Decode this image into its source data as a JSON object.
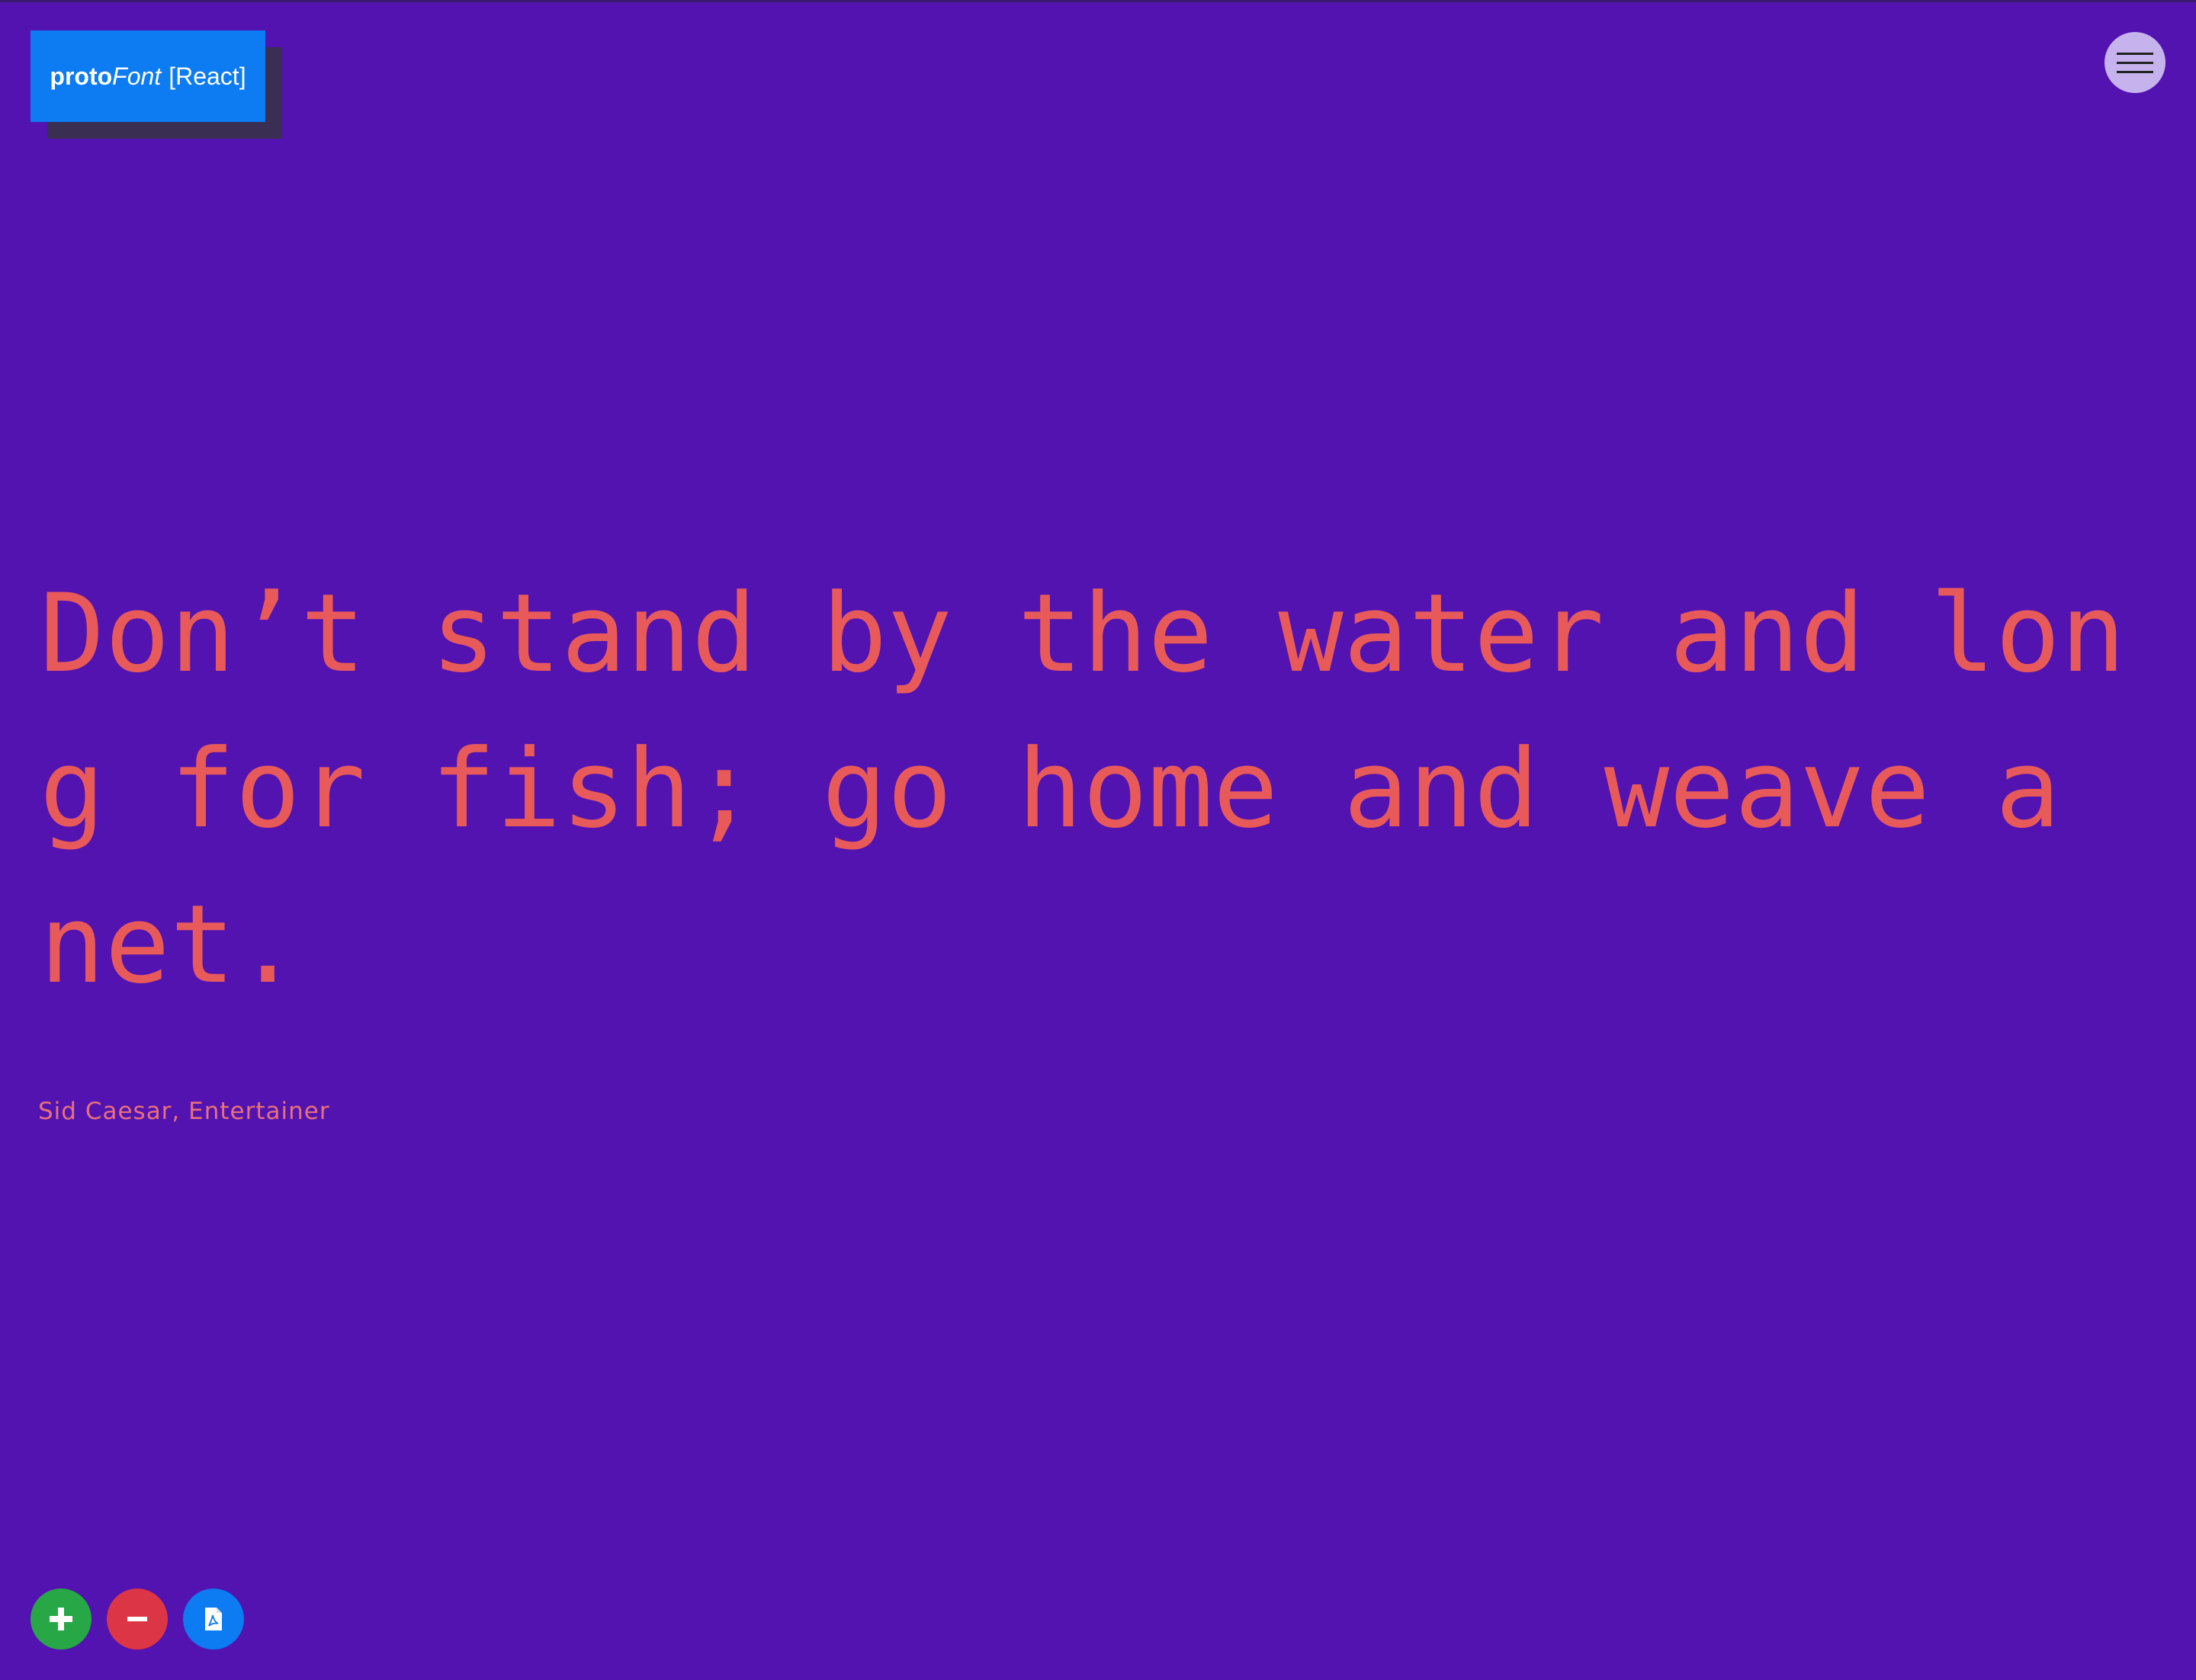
{
  "logo": {
    "proto": "proto",
    "font": "Font",
    "framework": "[React]"
  },
  "menu": {
    "icon": "hamburger-icon"
  },
  "quote": {
    "text": "Don’t stand by the water and long for fish; go home and weave a net.",
    "author": "Sid Caesar, Entertainer"
  },
  "controls": [
    {
      "icon": "plus-icon",
      "action": "increase"
    },
    {
      "icon": "minus-icon",
      "action": "decrease"
    },
    {
      "icon": "pdf-file-icon",
      "action": "export-pdf"
    }
  ],
  "colors": {
    "background": "#5213b0",
    "quote_text": "#e85a5a",
    "logo_bg": "#0d7bf2",
    "menu_bg": "#c6b3ee",
    "plus_bg": "#27a745",
    "minus_bg": "#dc3545",
    "pdf_bg": "#0d7bf2"
  }
}
